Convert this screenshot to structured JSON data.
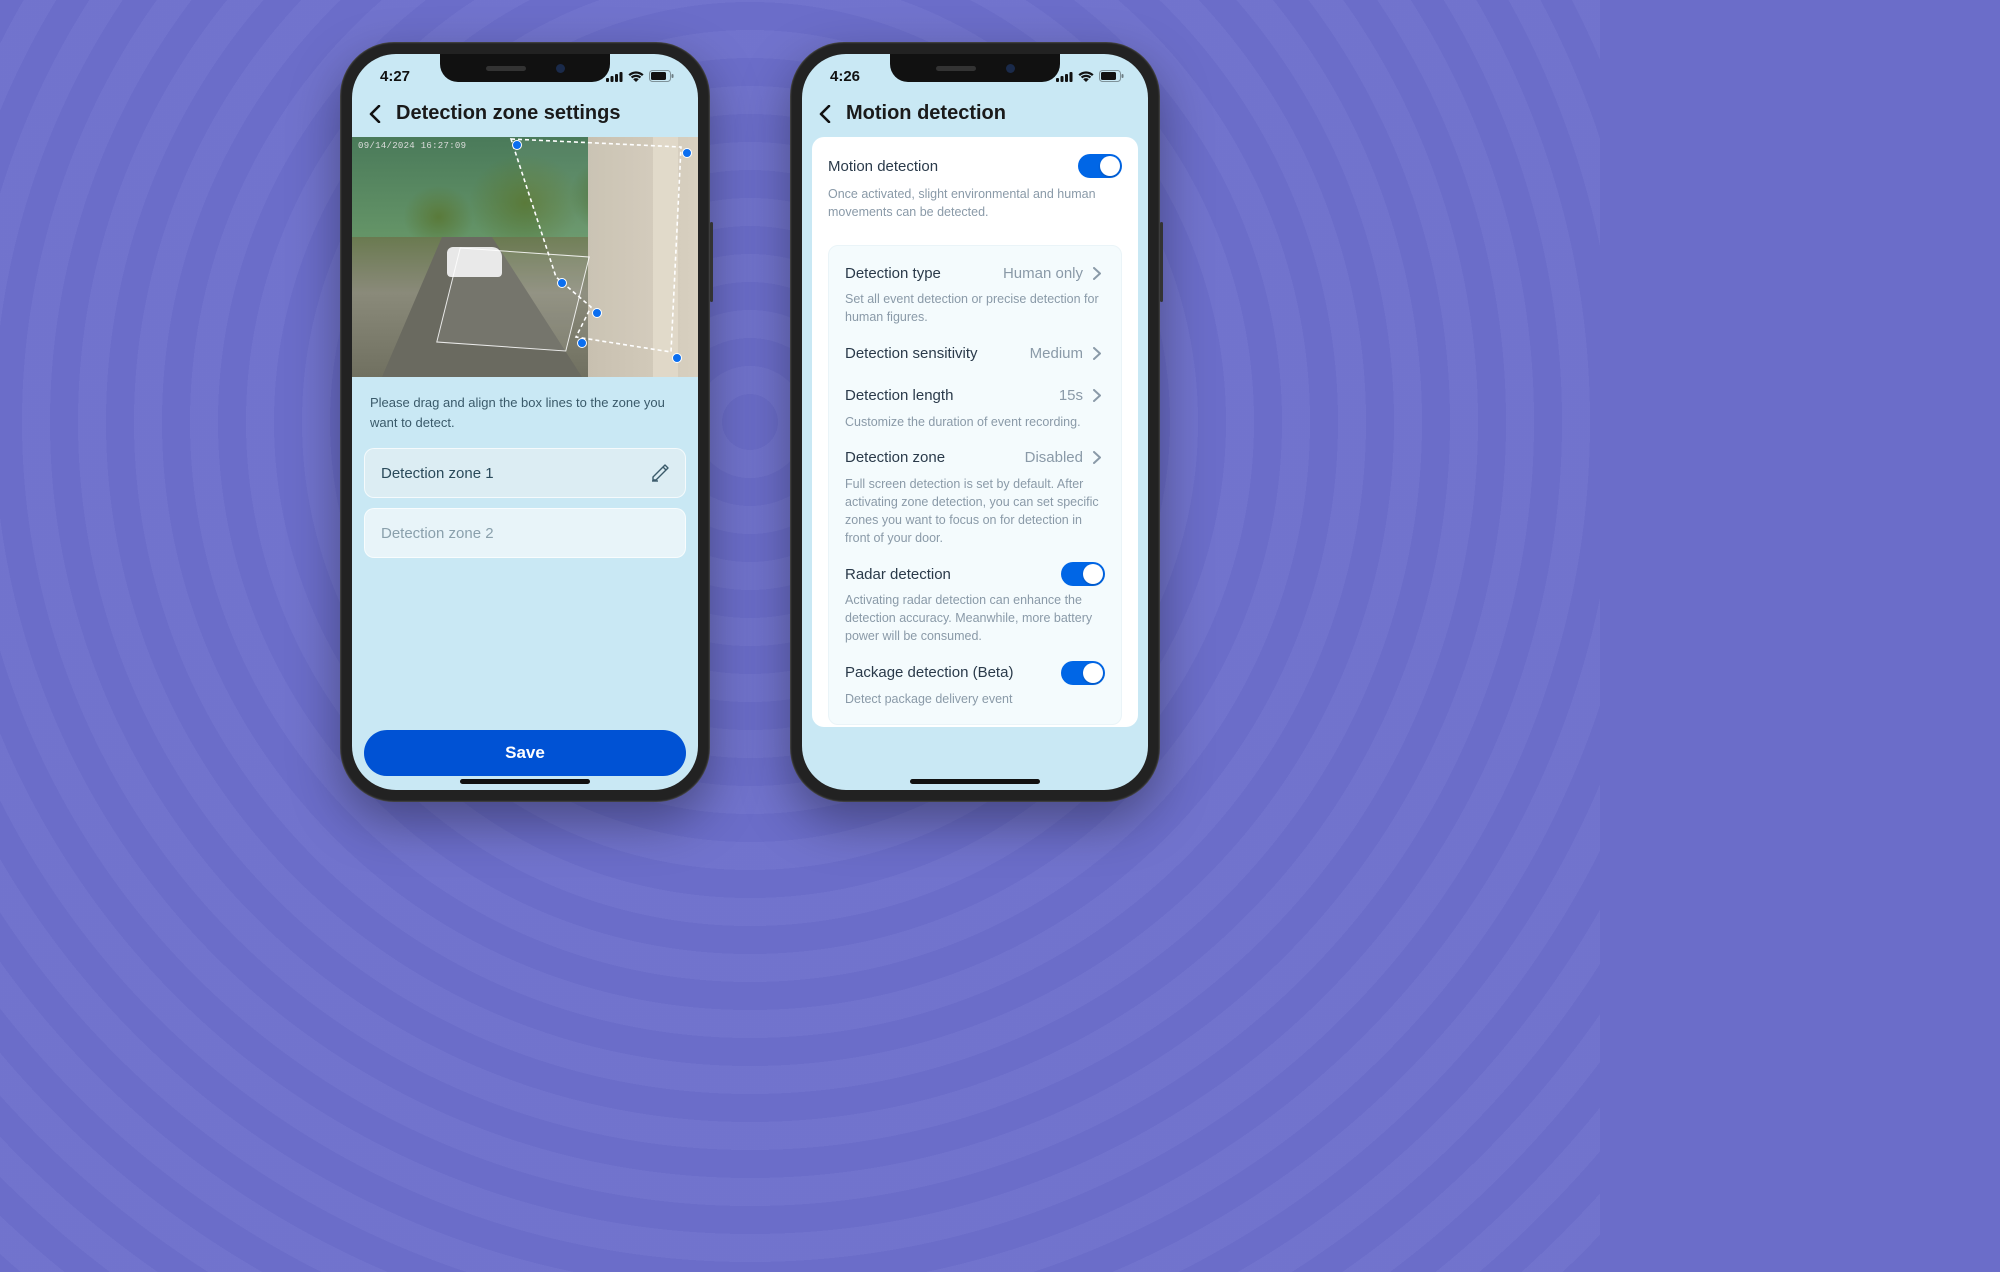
{
  "left": {
    "status_time": "4:27",
    "title": "Detection zone settings",
    "preview_timestamp": "09/14/2024  16:27:09",
    "helper_text": "Please drag and align the box lines to the zone you want to detect.",
    "zones": [
      {
        "label": "Detection zone 1",
        "active": true
      },
      {
        "label": "Detection zone 2",
        "active": false
      }
    ],
    "save_label": "Save"
  },
  "right": {
    "status_time": "4:26",
    "title": "Motion detection",
    "motion_detection": {
      "title": "Motion detection",
      "enabled": true,
      "desc": "Once activated, slight environmental and human movements can be detected."
    },
    "detection_type": {
      "title": "Detection type",
      "value": "Human only",
      "desc": "Set all event detection or precise detection for human figures."
    },
    "detection_sensitivity": {
      "title": "Detection sensitivity",
      "value": "Medium"
    },
    "detection_length": {
      "title": "Detection length",
      "value": "15s",
      "desc": "Customize the duration of event recording."
    },
    "detection_zone": {
      "title": "Detection zone",
      "value": "Disabled",
      "desc": "Full screen detection is set by default. After activating zone detection, you can set specific zones you want to focus on for detection in front of your door."
    },
    "radar_detection": {
      "title": "Radar detection",
      "enabled": true,
      "desc": "Activating radar detection can enhance the detection accuracy. Meanwhile, more battery power will be consumed."
    },
    "package_detection": {
      "title": "Package detection (Beta)",
      "enabled": true,
      "desc": "Detect package delivery event"
    }
  },
  "colors": {
    "primary": "#0052d4",
    "toggle": "#0066e6",
    "background": "#6b6dc9"
  }
}
